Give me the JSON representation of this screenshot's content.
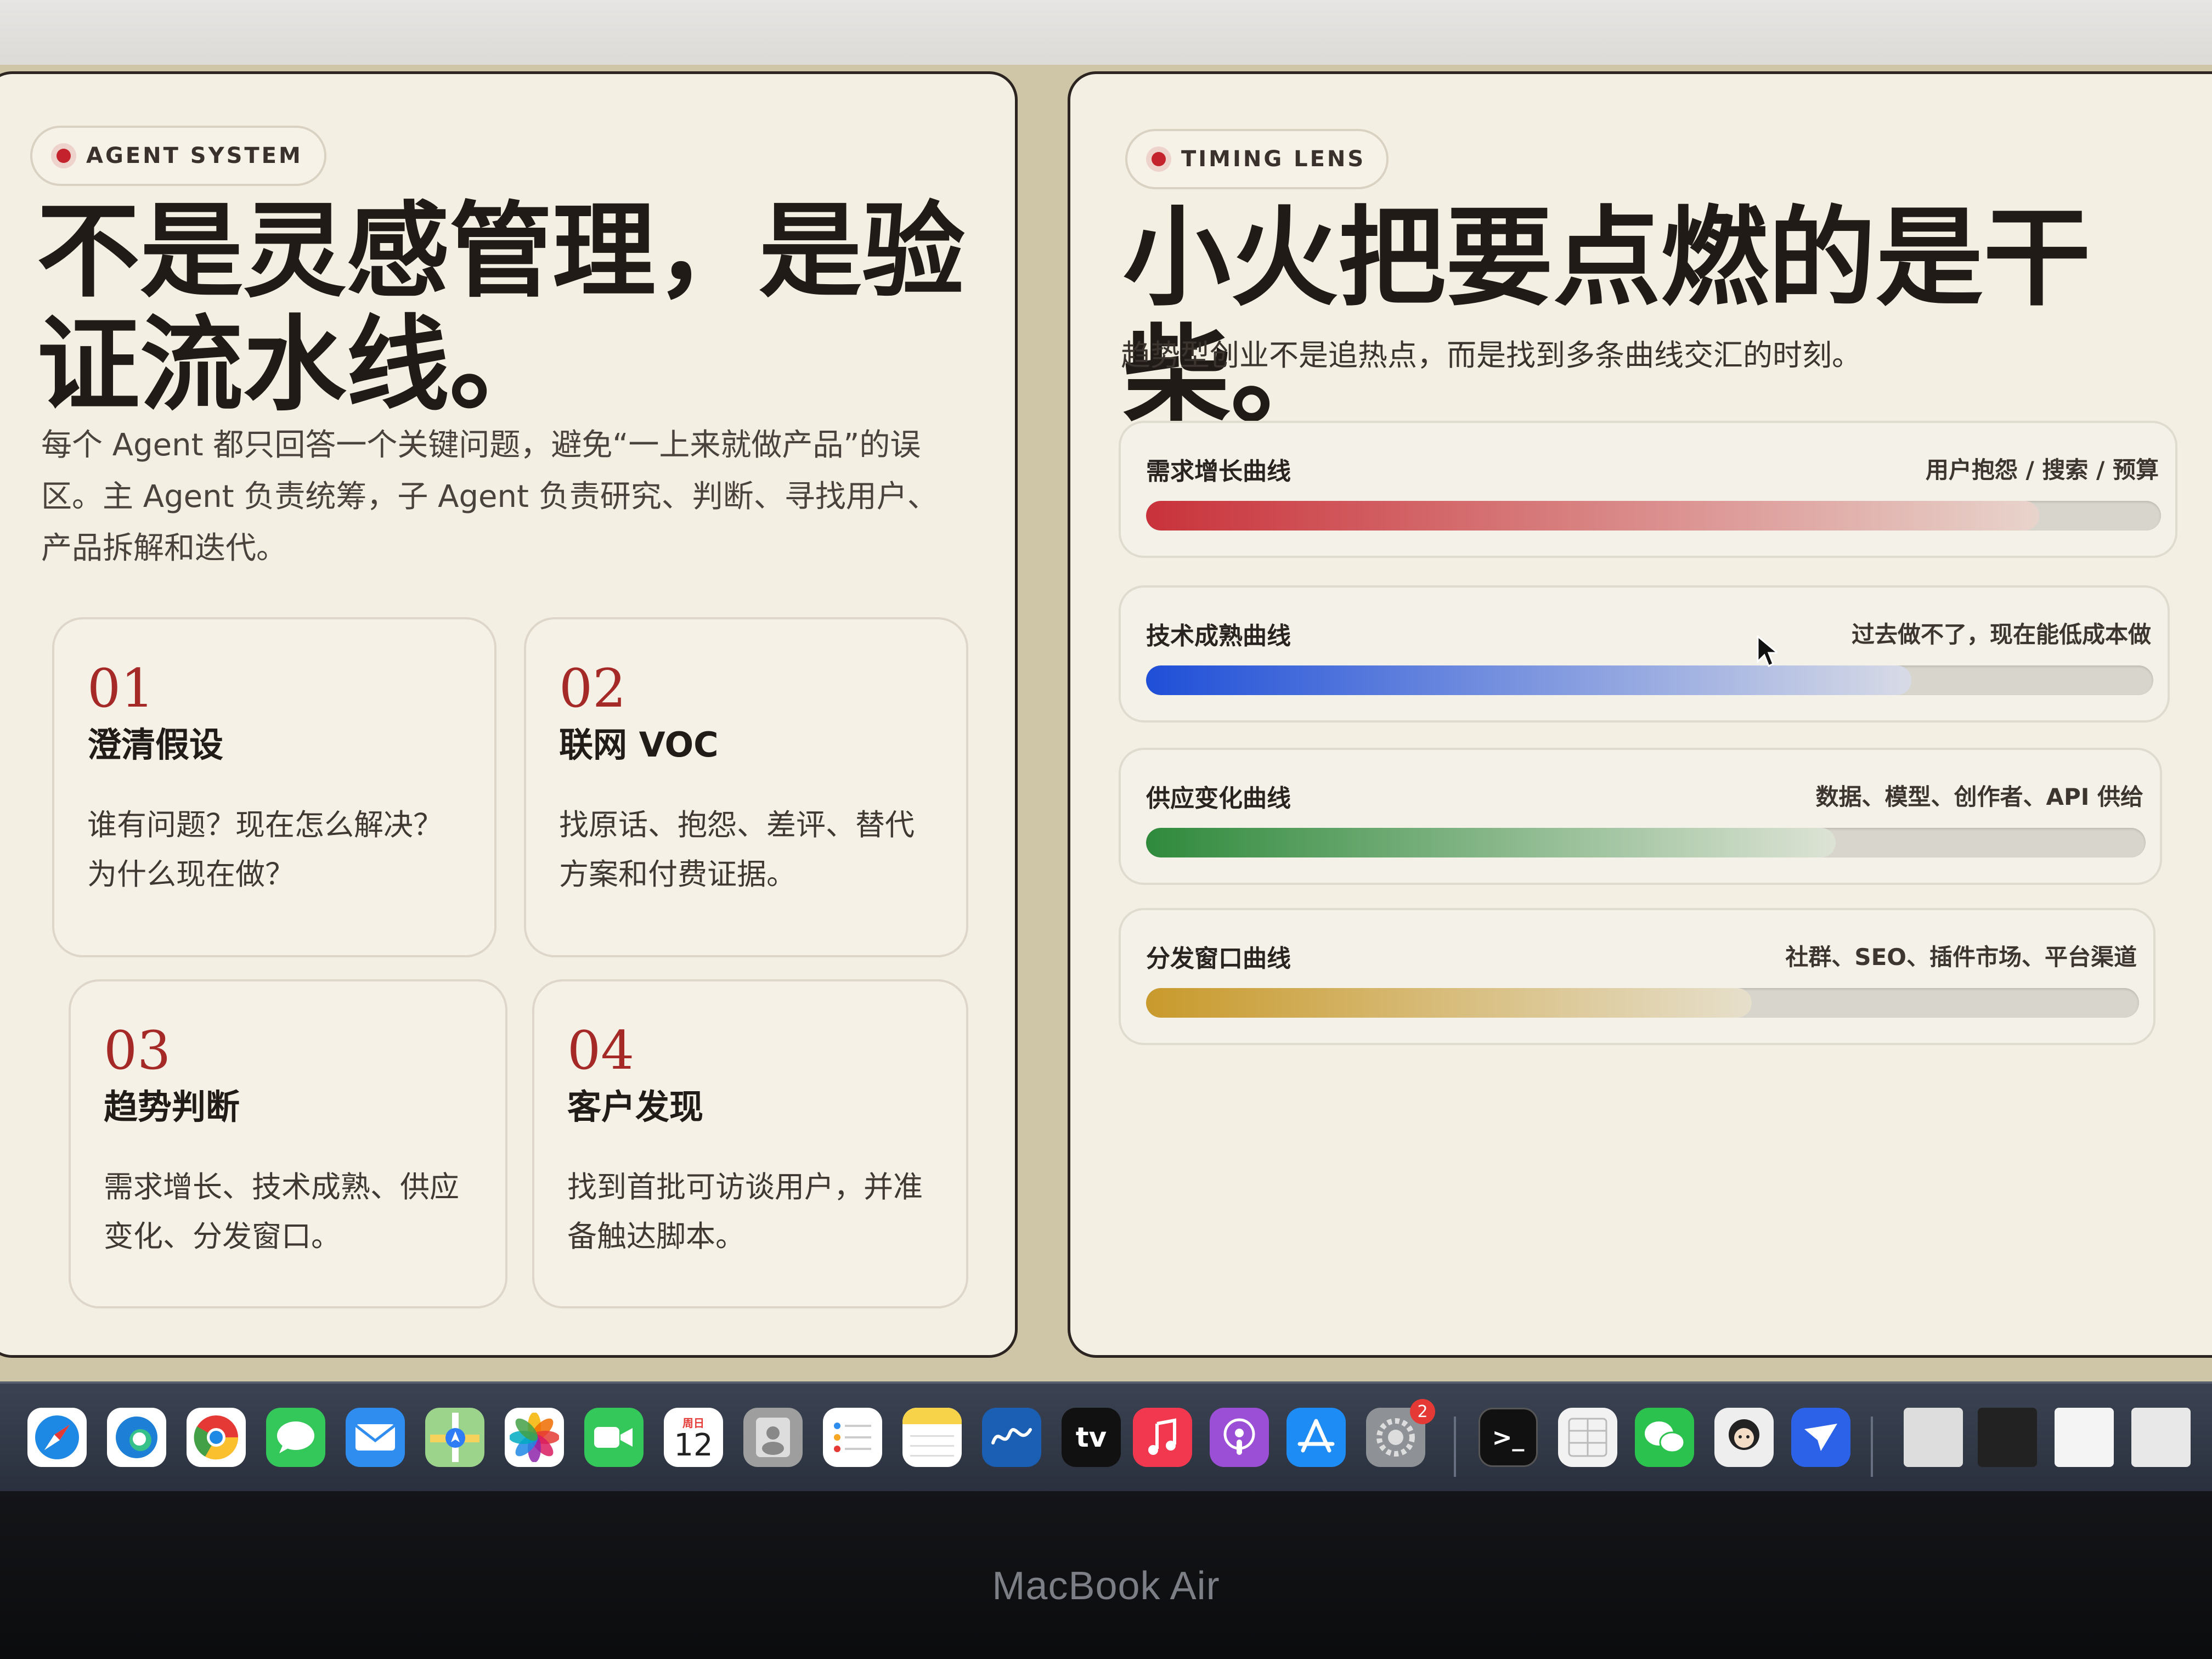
{
  "left_panel": {
    "tag": "AGENT SYSTEM",
    "headline_line1": "不是灵感管理，是验",
    "headline_line2": "证流水线。",
    "description_line1": "每个 Agent 都只回答一个关键问题，避免“一上来就做产品”的误",
    "description_line2": "区。主 Agent 负责统筹，子 Agent 负责研究、判断、寻找用户、",
    "description_line3": "产品拆解和迭代。",
    "cards": [
      {
        "number": "01",
        "title": "澄清假设",
        "desc_line1": "谁有问题？现在怎么解决？",
        "desc_line2": "为什么现在做？"
      },
      {
        "number": "02",
        "title": "联网 VOC",
        "desc_line1": "找原话、抱怨、差评、替代",
        "desc_line2": "方案和付费证据。"
      },
      {
        "number": "03",
        "title": "趋势判断",
        "desc_line1": "需求增长、技术成熟、供应",
        "desc_line2": "变化、分发窗口。"
      },
      {
        "number": "04",
        "title": "客户发现",
        "desc_line1": "找到首批可访谈用户，并准",
        "desc_line2": "备触达脚本。"
      }
    ]
  },
  "right_panel": {
    "tag": "TIMING LENS",
    "headline": "小火把要点燃的是干柴。",
    "subtitle": "趋势型创业不是追热点，而是找到多条曲线交汇的时刻。",
    "curves": [
      {
        "label": "需求增长曲线",
        "note": "用户抱怨 / 搜索 / 预算",
        "progress": 0.88,
        "color_start": "#c9323a",
        "color_end": "#e8d4cc"
      },
      {
        "label": "技术成熟曲线",
        "note": "过去做不了，现在能低成本做",
        "progress": 0.76,
        "color_start": "#1f4fd8",
        "color_end": "#d8dbe6"
      },
      {
        "label": "供应变化曲线",
        "note": "数据、模型、创作者、API 供给",
        "progress": 0.69,
        "color_start": "#2f8a3c",
        "color_end": "#dde3d5"
      },
      {
        "label": "分发窗口曲线",
        "note": "社群、SEO、插件市场、平台渠道",
        "progress": 0.61,
        "color_start": "#c99a2c",
        "color_end": "#e6dfcb"
      }
    ]
  },
  "dock": {
    "calendar_month": "周日",
    "calendar_day": "12",
    "settings_badge": "2",
    "tv_label": "tv",
    "terminal_label": ">_",
    "icons": [
      "safari-icon",
      "edge-icon",
      "chrome-icon",
      "messages-icon",
      "mail-icon",
      "maps-icon",
      "photos-icon",
      "facetime-icon",
      "calendar-icon",
      "contacts-icon",
      "reminders-icon",
      "notes-icon",
      "freeform-icon",
      "apple-tv-icon",
      "music-icon",
      "podcasts-icon",
      "app-store-icon",
      "system-settings-icon",
      "terminal-icon",
      "grid-app-icon",
      "wechat-icon",
      "avatar-app-icon",
      "feishu-icon"
    ]
  },
  "device_label": "MacBook Air"
}
